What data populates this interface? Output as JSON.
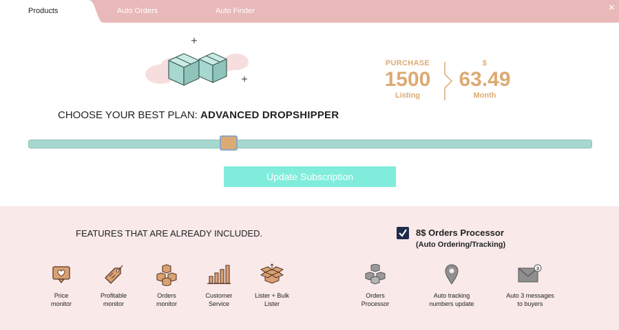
{
  "tabs": [
    {
      "label": "Products",
      "active": true
    },
    {
      "label": "Auto Orders",
      "active": false
    },
    {
      "label": "Auto Finder",
      "active": false
    }
  ],
  "close_label": "×",
  "summary": {
    "left_top": "PURCHASE",
    "left_value": "1500",
    "left_bottom": "Listing",
    "right_top": "$",
    "right_value": "63.49",
    "right_bottom": "Month"
  },
  "plan": {
    "prefix": "CHOOSE YOUR BEST PLAN:",
    "name": "ADVANCED DROPSHIPPER"
  },
  "slider": {
    "level_fraction": 0.35
  },
  "update_button": "Update Subscription",
  "features": {
    "heading": "FEATURES THAT ARE ALREADY INCLUDED.",
    "items": [
      {
        "line1": "Price",
        "line2": "monitor",
        "icon": "heart-tag-icon"
      },
      {
        "line1": "Profitable",
        "line2": "monitor",
        "icon": "price-tag-icon"
      },
      {
        "line1": "Orders",
        "line2": "monitor",
        "icon": "boxes-icon"
      },
      {
        "line1": "Customer",
        "line2": "Service",
        "icon": "bar-chart-icon"
      },
      {
        "line1": "Lister + Bulk",
        "line2": "Lister",
        "icon": "open-box-icon"
      }
    ]
  },
  "processor": {
    "title": "8$ Orders Processor",
    "subtitle": "(Auto Ordering/Tracking)",
    "checked": true,
    "items": [
      {
        "line1": "Orders",
        "line2": "Processor",
        "icon": "boxes-gray-icon"
      },
      {
        "line1": "Auto tracking",
        "line2": "numbers update",
        "icon": "location-pin-icon"
      },
      {
        "line1": "Auto 3 messages",
        "line2": "to buyers",
        "icon": "envelope-badge-icon"
      }
    ]
  },
  "colors": {
    "tab_bar": "#e8b9b8",
    "accent": "#dcaa72",
    "slider_track": "#a6d8cf",
    "button": "#80ecdc",
    "features_bg": "#f9e9e9",
    "checkbox": "#1f2b4a"
  }
}
